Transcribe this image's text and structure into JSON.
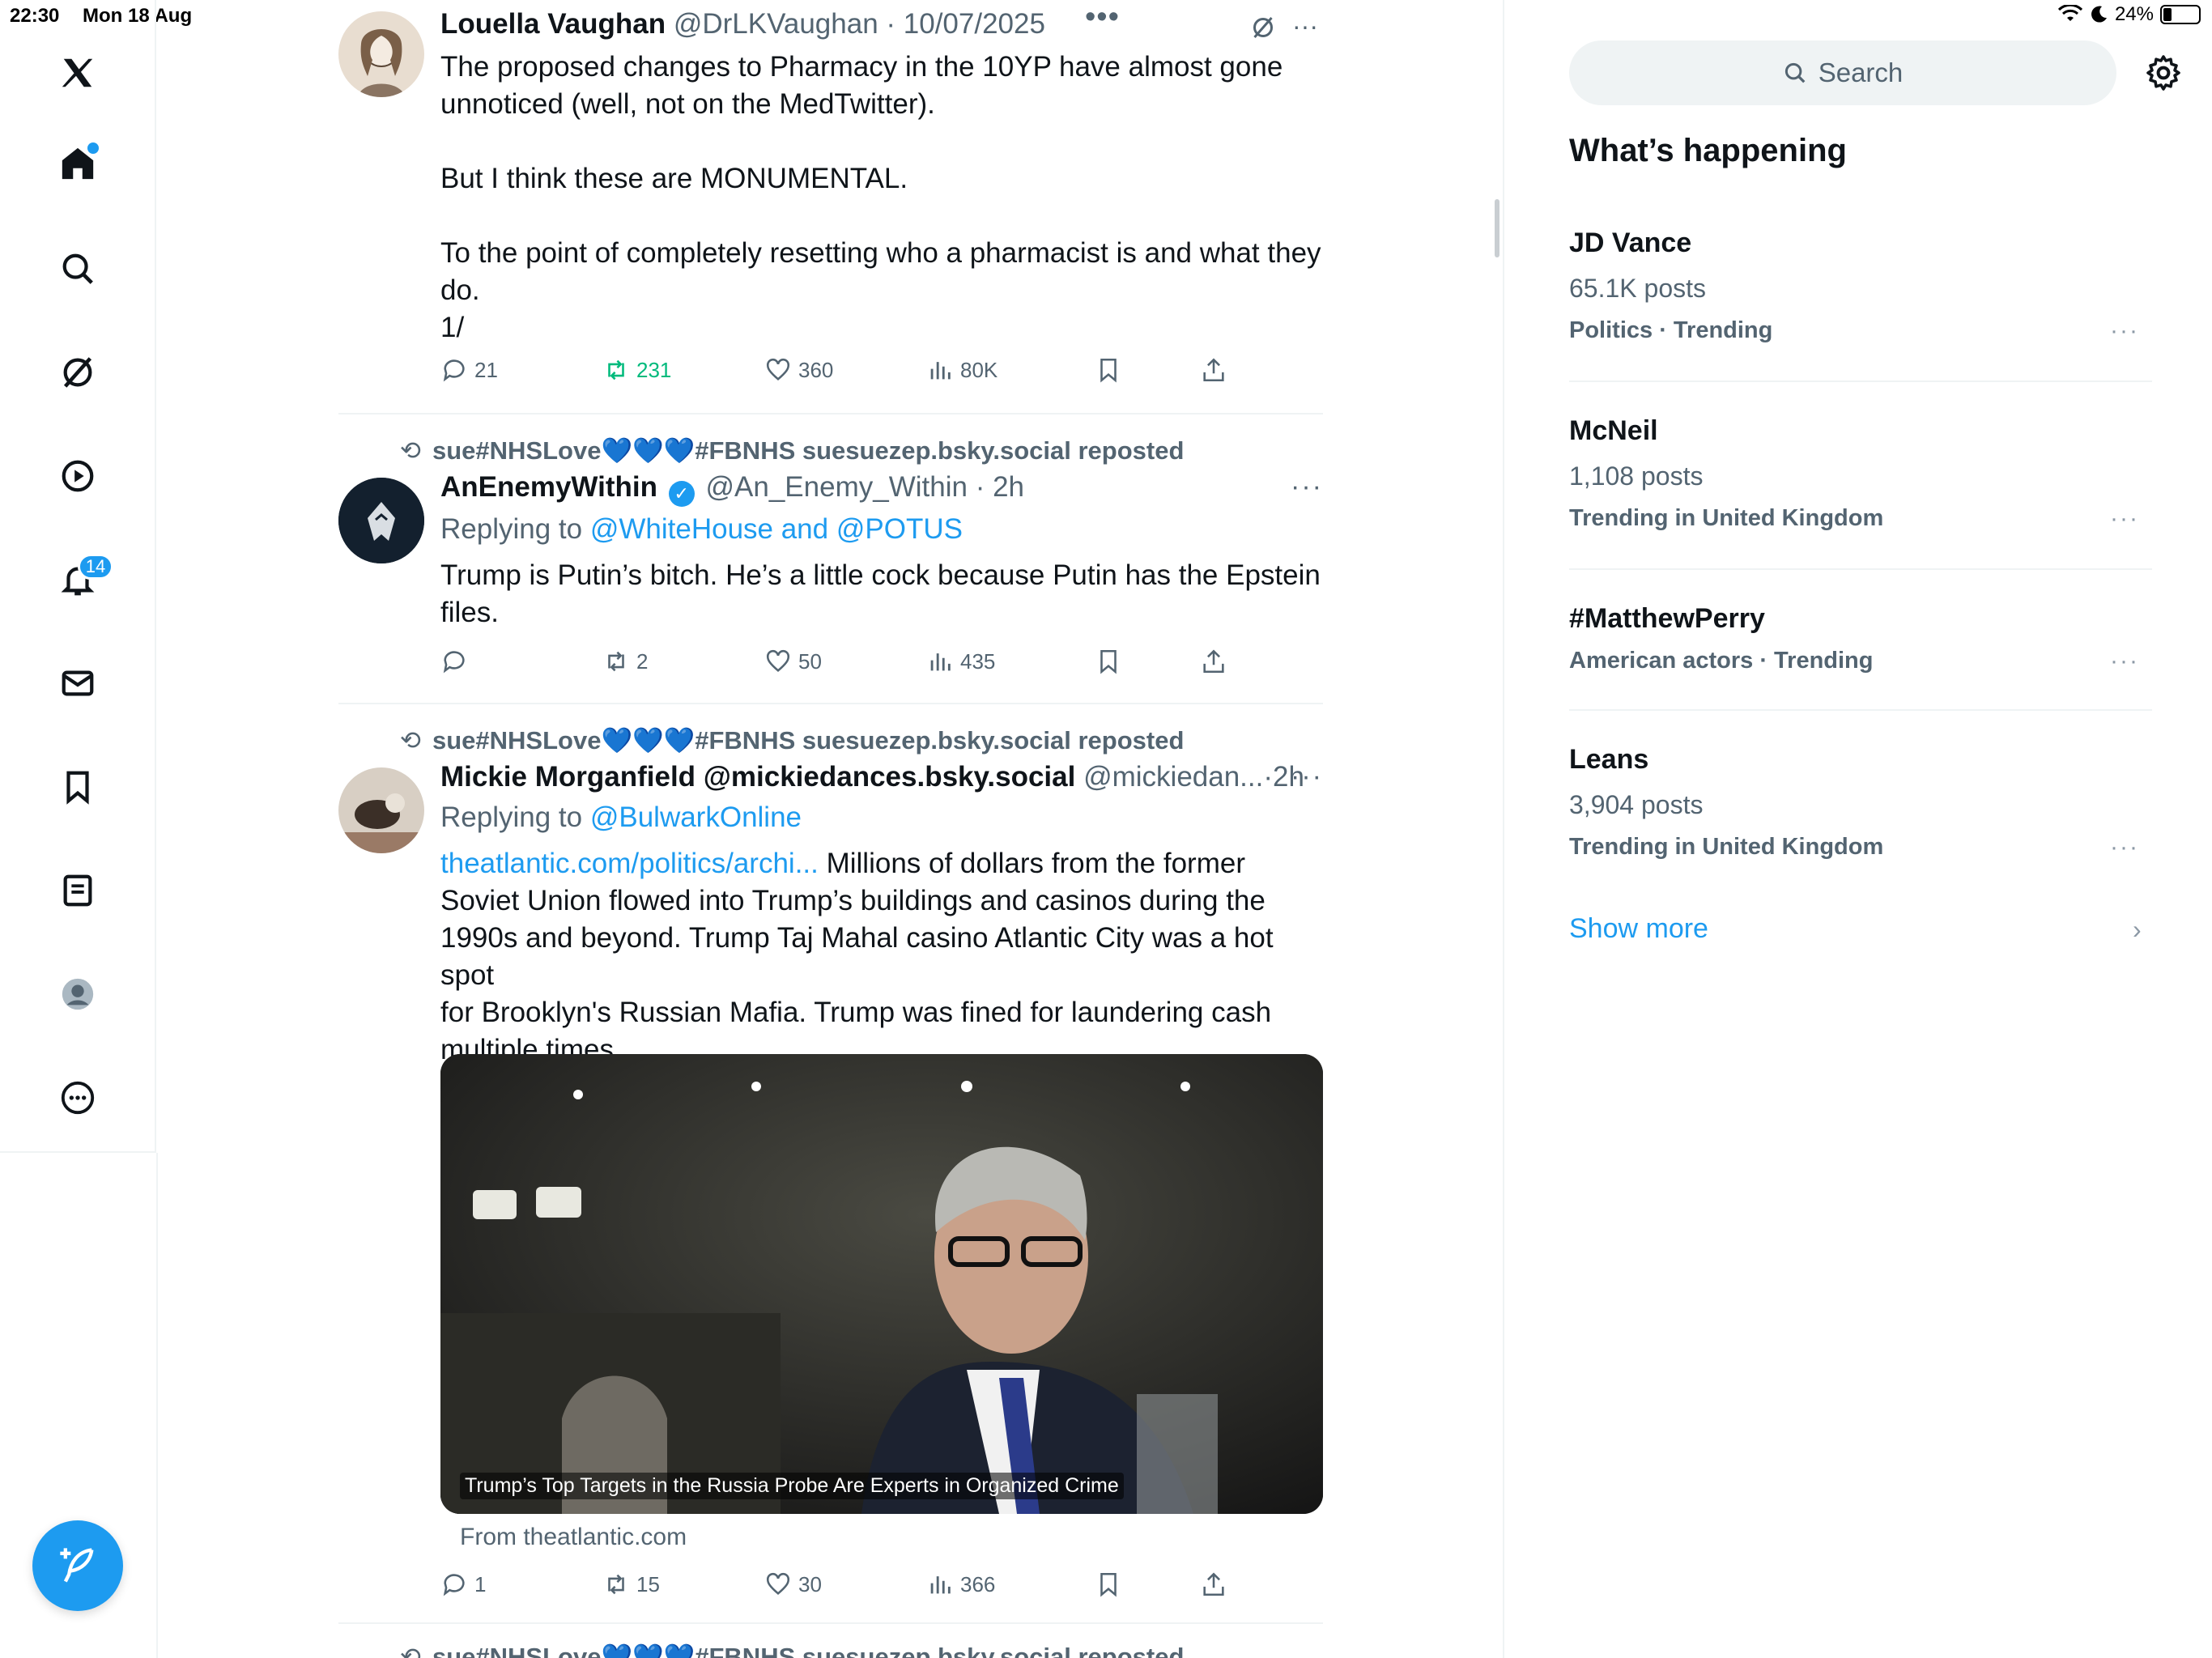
{
  "status_bar": {
    "time": "22:30",
    "date": "Mon 18 Aug",
    "battery": "24%",
    "icons": [
      "wifi-icon",
      "moon-icon",
      "battery-icon"
    ]
  },
  "nav": {
    "items": [
      "x-logo-icon",
      "home-icon",
      "search-icon",
      "grok-icon",
      "video-icon",
      "notifications-icon",
      "messages-icon",
      "bookmarks-icon",
      "lists-icon",
      "profile-icon",
      "more-icon"
    ],
    "notification_count": "14",
    "compose": "compose-icon"
  },
  "colors": {
    "accent": "#1d9bf0",
    "repost_active": "#00ba7c",
    "text_secondary": "#536471",
    "border": "#eff3f4"
  },
  "tweets": [
    {
      "name": "Louella Vaughan",
      "handle": "@DrLKVaughan",
      "dot": "·",
      "time": "10/07/2025",
      "more": "•••",
      "small_more": "···",
      "lines": [
        "The proposed changes to Pharmacy in the 10YP have almost gone",
        "unnoticed (well, not on the MedTwitter).",
        "But I think these are MONUMENTAL.",
        "To the point of completely resetting who a pharmacist is and what they",
        "do.",
        "1/"
      ],
      "replies": "21",
      "reposts": "231",
      "likes": "360",
      "views": "80K"
    },
    {
      "reposted_by": "sue#NHSLove💙💙💙#FBNHS suesuezep.bsky.social reposted",
      "name": "AnEnemyWithin",
      "handle": "@An_Enemy_Within",
      "dot": "·",
      "time": "2h",
      "more": "···",
      "replying_label": "Replying to ",
      "replying_to": "@WhiteHouse and @POTUS",
      "lines": [
        "Trump is Putin’s bitch. He’s a little cock because Putin has the Epstein",
        "files."
      ],
      "replies": "",
      "reposts": "2",
      "likes": "50",
      "views": "435"
    },
    {
      "reposted_by": "sue#NHSLove💙💙💙#FBNHS suesuezep.bsky.social reposted",
      "name": "Mickie Morganfield @mickiedances.bsky.social",
      "handle": "@mickiedan...",
      "dot": "·",
      "time": "2h",
      "more": "···",
      "replying_label": "Replying to ",
      "replying_to": "@BulwarkOnline",
      "link_text": "theatlantic.com/politics/archi...",
      "first_line_rest": " Millions of dollars from the former",
      "lines": [
        "Soviet Union flowed into Trump’s buildings and casinos during the",
        "1990s and beyond. Trump Taj Mahal casino Atlantic City was a hot spot",
        "for Brooklyn's Russian Mafia. Trump was fined for laundering cash",
        "multiple times."
      ],
      "card_caption": "Trump’s Top Targets in the Russia Probe Are Experts in Organized Crime",
      "card_source": "From theatlantic.com",
      "replies": "1",
      "reposts": "15",
      "likes": "30",
      "views": "366"
    },
    {
      "reposted_by": "sue#NHSLove💙💙💙#FBNHS suesuezep.bsky.social reposted"
    }
  ],
  "sidebar": {
    "search_placeholder": "Search",
    "section_title": "What’s happening",
    "trends": [
      {
        "title": "JD Vance",
        "posts": "65.1K posts",
        "meta": "Politics · Trending"
      },
      {
        "title": "McNeil",
        "posts": "1,108 posts",
        "meta": "Trending in United Kingdom"
      },
      {
        "title": "#MatthewPerry",
        "posts": "",
        "meta": "American actors · Trending"
      },
      {
        "title": "Leans",
        "posts": "3,904 posts",
        "meta": "Trending in United Kingdom"
      }
    ],
    "more_label": "···",
    "show_more": "Show more",
    "chevron": "›"
  }
}
